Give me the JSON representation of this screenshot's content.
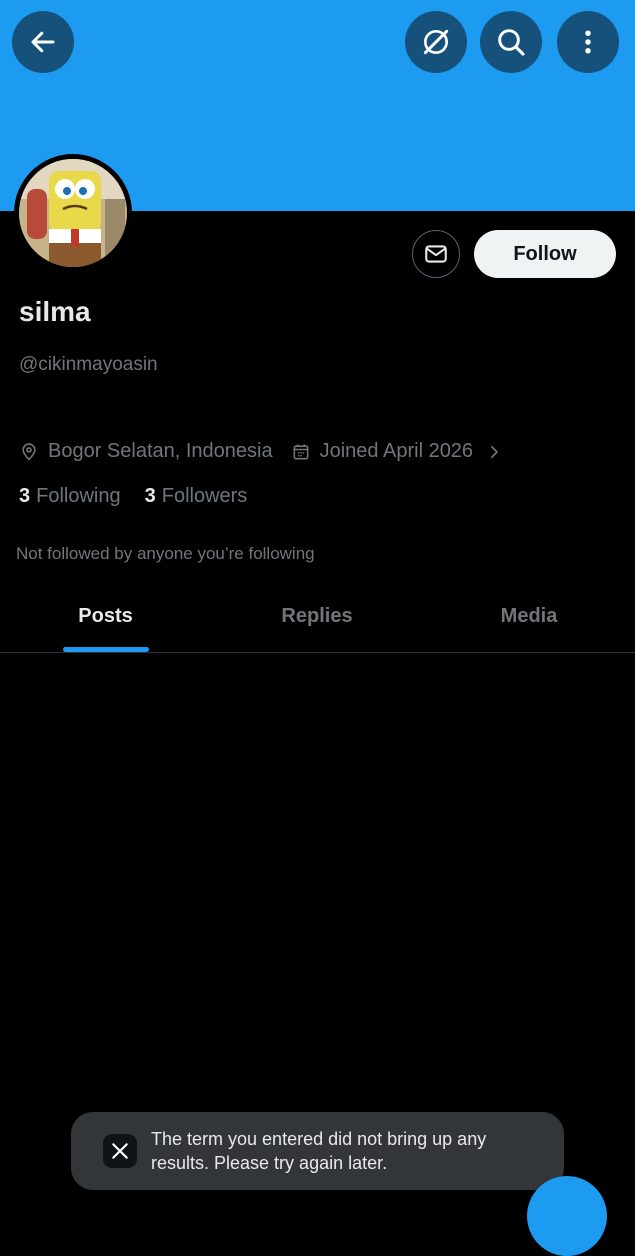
{
  "colors": {
    "accent": "#1d9bf0",
    "background": "#000000",
    "text_primary": "#e7e9ea",
    "text_secondary": "#71767b"
  },
  "header": {
    "back_icon": "arrow-left-icon",
    "grok_icon": "grok-icon",
    "search_icon": "search-icon",
    "more_icon": "more-vertical-icon"
  },
  "profile": {
    "display_name": "silma",
    "handle": "@cikinmayoasin",
    "location": "Bogor Selatan, Indonesia",
    "joined": "Joined April 2026",
    "following_count": "3",
    "following_label": "Following",
    "followers_count": "3",
    "followers_label": "Followers",
    "not_followed_text": "Not followed by anyone you’re following"
  },
  "actions": {
    "message_icon": "mail-icon",
    "follow_label": "Follow"
  },
  "tabs": [
    {
      "label": "Posts",
      "active": true
    },
    {
      "label": "Replies",
      "active": false
    },
    {
      "label": "Media",
      "active": false
    }
  ],
  "toast": {
    "icon": "x-logo-icon",
    "message": "The term you entered did not bring up any results. Please try again later."
  }
}
